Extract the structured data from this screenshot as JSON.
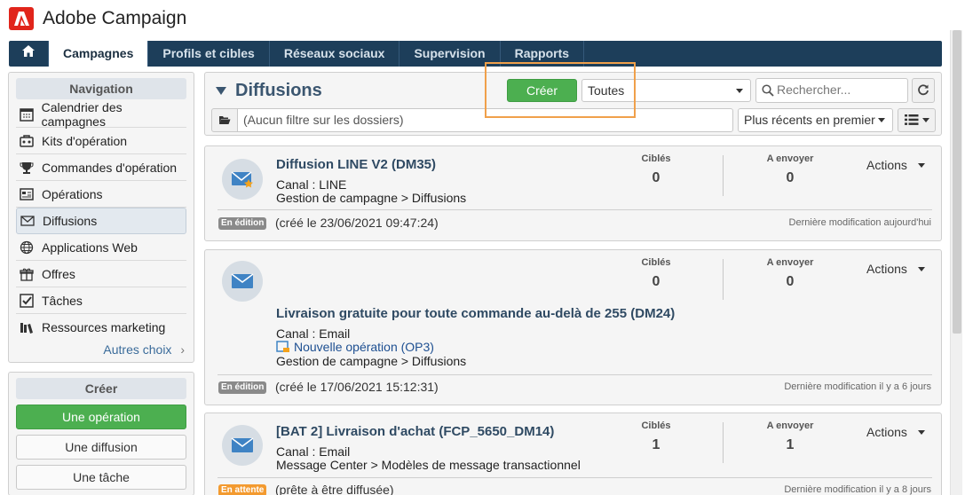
{
  "app": {
    "title": "Adobe Campaign"
  },
  "topnav": {
    "items": [
      "Campagnes",
      "Profils et cibles",
      "Réseaux sociaux",
      "Supervision",
      "Rapports"
    ]
  },
  "navigation": {
    "header": "Navigation",
    "items": [
      {
        "label": "Calendrier des campagnes",
        "icon": "calendar-icon"
      },
      {
        "label": "Kits d'opération",
        "icon": "kit-icon"
      },
      {
        "label": "Commandes d'opération",
        "icon": "trophy-icon"
      },
      {
        "label": "Opérations",
        "icon": "operations-icon"
      },
      {
        "label": "Diffusions",
        "icon": "envelope-icon",
        "selected": true
      },
      {
        "label": "Applications Web",
        "icon": "globe-icon"
      },
      {
        "label": "Offres",
        "icon": "gift-icon"
      },
      {
        "label": "Tâches",
        "icon": "checkbox-icon"
      },
      {
        "label": "Ressources marketing",
        "icon": "books-icon"
      }
    ],
    "more": "Autres choix"
  },
  "create": {
    "header": "Créer",
    "buttons": [
      "Une opération",
      "Une diffusion",
      "Une tâche"
    ]
  },
  "list": {
    "title": "Diffusions",
    "create_label": "Créer",
    "type_filter": "Toutes",
    "search_placeholder": "Rechercher...",
    "folder_filter": "(Aucun filtre sur les dossiers)",
    "sort": "Plus récents en premier"
  },
  "deliveries": [
    {
      "name": "Diffusion LINE V2 (DM35)",
      "channel": "Canal : LINE",
      "path": "Gestion de campagne > Diffusions",
      "targeted_label": "Ciblés",
      "targeted": "0",
      "to_send_label": "A envoyer",
      "to_send": "0",
      "actions": "Actions",
      "status": "En édition",
      "created": "(créé le 23/06/2021 09:47:24)",
      "modified": "Dernière modification aujourd'hui"
    },
    {
      "name": "Livraison gratuite pour toute commande au-delà de 255 (DM24)",
      "channel": "Canal : Email",
      "operation": "Nouvelle opération (OP3)",
      "path": "Gestion de campagne > Diffusions",
      "targeted_label": "Ciblés",
      "targeted": "0",
      "to_send_label": "A envoyer",
      "to_send": "0",
      "actions": "Actions",
      "status": "En édition",
      "created": "(créé le 17/06/2021 15:12:31)",
      "modified": "Dernière modification il y a 6 jours"
    },
    {
      "name": "[BAT 2] Livraison d'achat (FCP_5650_DM14)",
      "channel": "Canal : Email",
      "path": "Message Center > Modèles de message transactionnel",
      "targeted_label": "Ciblés",
      "targeted": "1",
      "to_send_label": "A envoyer",
      "to_send": "1",
      "actions": "Actions",
      "status": "En attente",
      "created": "(prête à être diffusée)",
      "modified": "Dernière modification il y a 8 jours"
    }
  ],
  "colors": {
    "brand": "#e1251b",
    "nav_bg": "#1d3e5a",
    "create_green": "#4caf50",
    "highlight_orange": "#f0a04b"
  }
}
